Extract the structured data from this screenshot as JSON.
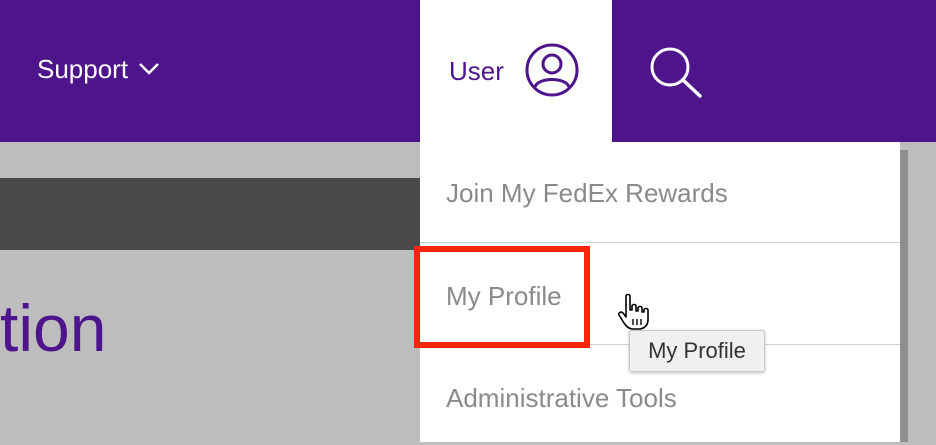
{
  "header": {
    "support_label": "Support",
    "user_label": "User"
  },
  "page": {
    "heading_fragment": "tion"
  },
  "user_menu": {
    "items": [
      {
        "label": "Join My FedEx Rewards"
      },
      {
        "label": "My Profile"
      },
      {
        "label": "Administrative Tools"
      }
    ]
  },
  "tooltip": {
    "text": "My Profile"
  },
  "colors": {
    "brand_purple": "#4d148c",
    "highlight_red": "#f5260c"
  }
}
